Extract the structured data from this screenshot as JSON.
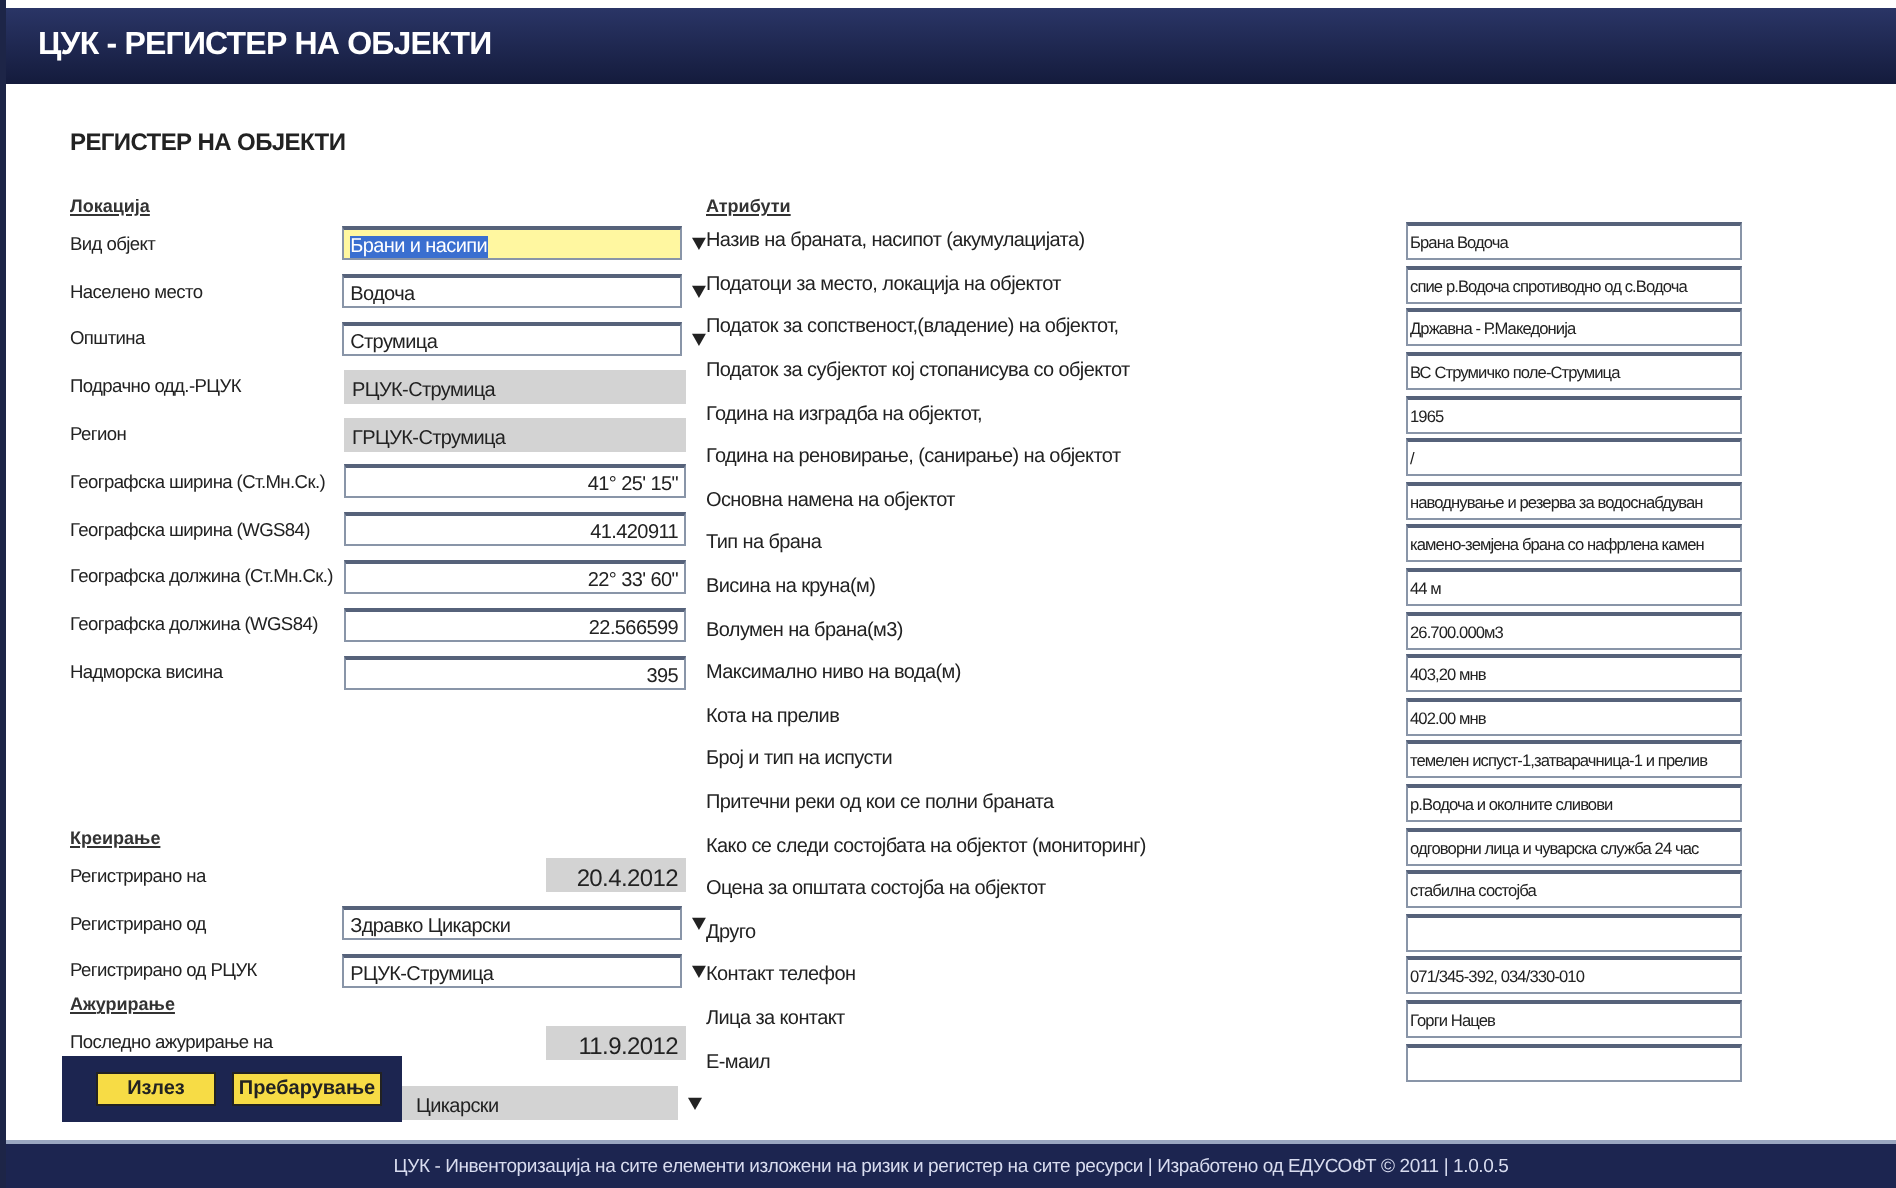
{
  "window": {
    "title": "ЦУК - РЕГИСТЕР НА ОБЈЕКТИ"
  },
  "page_title": "РЕГИСТЕР НА ОБЈЕКТИ",
  "location": {
    "heading": "Локација",
    "fields": [
      {
        "label": "Вид објект",
        "value": "Брани и насипи",
        "kind": "select",
        "focused": true
      },
      {
        "label": "Населено место",
        "value": "Водоча",
        "kind": "select",
        "focused": false
      },
      {
        "label": "Општина",
        "value": "Струмица",
        "kind": "select",
        "focused": false
      },
      {
        "label": "Подрачно одд.-РЦУК",
        "value": "РЦУК-Струмица",
        "kind": "readonly",
        "focused": false
      },
      {
        "label": "Регион",
        "value": "ГРЦУК-Струмица",
        "kind": "readonly",
        "focused": false
      },
      {
        "label": "Географска ширина (Ст.Мн.Ск.)",
        "value": "41° 25' 15\"",
        "kind": "number",
        "focused": false
      },
      {
        "label": "Географска ширина (WGS84)",
        "value": "41.420911",
        "kind": "number",
        "focused": false
      },
      {
        "label": "Географска должина (Ст.Мн.Ск.)",
        "value": "22° 33' 60\"",
        "kind": "number",
        "focused": false
      },
      {
        "label": "Географска должина (WGS84)",
        "value": "22.566599",
        "kind": "number",
        "focused": false
      },
      {
        "label": "Надморска висина",
        "value": "395",
        "kind": "number",
        "focused": false
      }
    ]
  },
  "created": {
    "heading": "Креирање",
    "fields": [
      {
        "label": "Регистрирано на",
        "value": "20.4.2012",
        "kind": "date"
      },
      {
        "label": "Регистрирано од",
        "value": "Здравко Цикарски",
        "kind": "select"
      },
      {
        "label": "Регистрирано од РЦУК",
        "value": "РЦУК-Струмица",
        "kind": "select"
      }
    ]
  },
  "updated": {
    "heading": "Ажурирање",
    "fields": [
      {
        "label": "Последно ажурирање на",
        "value": "11.9.2012",
        "kind": "date"
      }
    ],
    "covered_field": {
      "value": "Цикарски"
    }
  },
  "attributes": {
    "heading": "Атрибути",
    "fields": [
      {
        "label": "Назив на браната, насипот (акумулацијата)",
        "value": "Брана Водоча"
      },
      {
        "label": "Податоци за место, локација на објектот",
        "value": "спие р.Водоча спротиводно од с.Водоча"
      },
      {
        "label": "Податок за сопственост,(владение) на објектот,",
        "value": "Државна - Р.Македонија"
      },
      {
        "label": "Податок за субјектот кој стопанисува со објектот",
        "value": "ВС Струмичко поле-Струмица"
      },
      {
        "label": "Година на изградба на објектот,",
        "value": "1965"
      },
      {
        "label": "Година на реновирање, (санирање) на објектот",
        "value": "/"
      },
      {
        "label": "Основна намена на објектот",
        "value": "наводнување и резерва за водоснабдуван"
      },
      {
        "label": "Тип на брана",
        "value": "камено-земјена брана со нафрлена камен"
      },
      {
        "label": "Висина на круна(м)",
        "value": "44 м"
      },
      {
        "label": "Волумен на брана(м3)",
        "value": "26.700.000м3"
      },
      {
        "label": "Максимално ниво на вода(м)",
        "value": "403,20 мнв"
      },
      {
        "label": "Кота на прелив",
        "value": "402.00 мнв"
      },
      {
        "label": "Број и тип на испусти",
        "value": "темелен испуст-1,затварачница-1 и прелив"
      },
      {
        "label": "Притечни реки од кои се полни браната",
        "value": "р.Водоча и околните сливови"
      },
      {
        "label": "Како се следи состојбата на објектот (мониторинг)",
        "value": "одговорни лица и чуварска служба 24 час"
      },
      {
        "label": "Оцена за општата состојба на објектот",
        "value": "стабилна состојба"
      },
      {
        "label": "Друго"
      },
      {
        "label": "Контакт телефон",
        "value": "071/345-392, 034/330-010"
      },
      {
        "label": "Лица за контакт",
        "value": "Горги Нацев"
      },
      {
        "label": "Е-маил"
      }
    ]
  },
  "buttons": [
    "Излез",
    "Пребарување"
  ],
  "footer": "ЦУК - Инвенторизација на сите елементи изложени на ризик и регистер на сите ресурси | Изработено од ЕДУСОФТ © 2011 | 1.0.0.5"
}
